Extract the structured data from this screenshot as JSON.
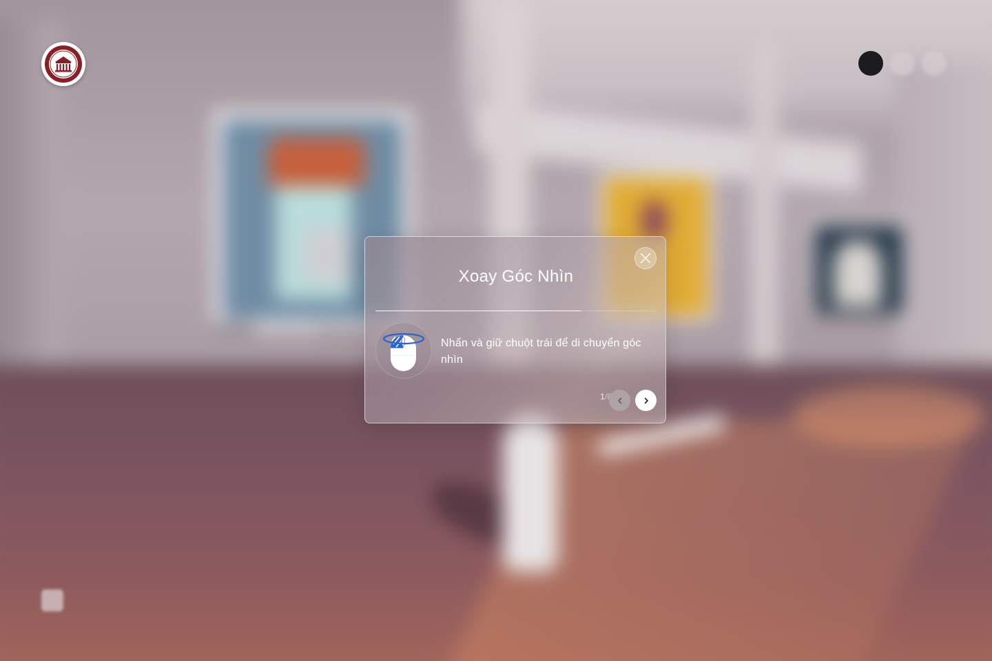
{
  "modal": {
    "title": "Xoay Góc Nhìn",
    "instruction": "Nhấn và giữ chuột trái để di chuyển góc nhìn",
    "instruction_icon": "mouse-rotate-icon",
    "step_current": "1",
    "step_separator": "/",
    "step_total": "8",
    "progress": 0.73,
    "close_icon": "close-icon",
    "prev_icon": "chevron-left-icon",
    "next_icon": "chevron-right-icon"
  },
  "logo": {
    "icon": "museum-seal-logo",
    "color": "#8b1e24"
  },
  "colors": {
    "accent_blue": "#2a63d6",
    "seal_red": "#8b1e24",
    "text": "#ffffff"
  }
}
